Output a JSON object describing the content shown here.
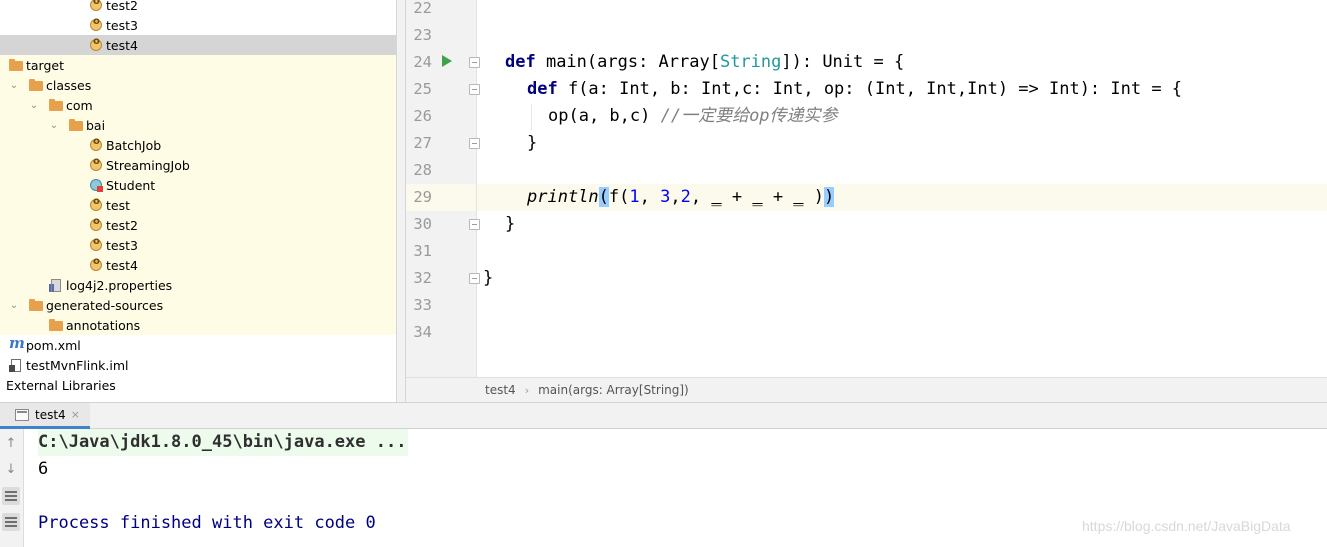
{
  "project_tree": {
    "items": [
      {
        "label": "test2",
        "icon": "scala-object-icon",
        "arrow": ""
      },
      {
        "label": "test3",
        "icon": "scala-object-icon",
        "arrow": ""
      },
      {
        "label": "test4",
        "icon": "scala-object-icon",
        "arrow": "",
        "selected": true
      },
      {
        "label": "target",
        "icon": "folder-icon",
        "arrow": ""
      },
      {
        "label": "classes",
        "icon": "folder-icon",
        "arrow": "⌄"
      },
      {
        "label": "com",
        "icon": "folder-icon",
        "arrow": "⌄"
      },
      {
        "label": "bai",
        "icon": "folder-icon",
        "arrow": "⌄"
      },
      {
        "label": "BatchJob",
        "icon": "scala-object-icon",
        "arrow": ""
      },
      {
        "label": "StreamingJob",
        "icon": "scala-object-icon",
        "arrow": ""
      },
      {
        "label": "Student",
        "icon": "scala-class-icon",
        "arrow": ""
      },
      {
        "label": "test",
        "icon": "scala-object-icon",
        "arrow": ""
      },
      {
        "label": "test2",
        "icon": "scala-object-icon",
        "arrow": ""
      },
      {
        "label": "test3",
        "icon": "scala-object-icon",
        "arrow": ""
      },
      {
        "label": "test4",
        "icon": "scala-object-icon",
        "arrow": ""
      },
      {
        "label": "log4j2.properties",
        "icon": "properties-file-icon",
        "arrow": ""
      },
      {
        "label": "generated-sources",
        "icon": "folder-icon",
        "arrow": "⌄"
      },
      {
        "label": "annotations",
        "icon": "folder-icon",
        "arrow": ""
      },
      {
        "label": "pom.xml",
        "icon": "maven-pom-icon",
        "arrow": ""
      },
      {
        "label": "testMvnFlink.iml",
        "icon": "iml-file-icon",
        "arrow": ""
      },
      {
        "label": "External Libraries",
        "icon": "",
        "arrow": ""
      }
    ]
  },
  "editor": {
    "line_numbers": [
      "22",
      "23",
      "24",
      "25",
      "26",
      "27",
      "28",
      "29",
      "30",
      "31",
      "32",
      "33",
      "34"
    ],
    "code": {
      "l24_kw": "def",
      "l24_a": " main(args: Array[",
      "l24_type": "String",
      "l24_b": "]): Unit = {",
      "l25_kw": "def",
      "l25_a": " f(a: Int, b: Int,c: Int, op: (Int, Int,Int) => Int): Int = {",
      "l26_a": "op(a, b,c) ",
      "l26_comment": "//一定要给op传递实参",
      "l27": "}",
      "l29_fn": "println",
      "l29_open": "(",
      "l29_a": "f(",
      "l29_n1": "1",
      "l29_c1": ", ",
      "l29_n2": "3",
      "l29_c2": ",",
      "l29_n3": "2",
      "l29_c3": ", ",
      "l29_u1": "_",
      "l29_p1": " + ",
      "l29_u2": "_",
      "l29_p2": " + ",
      "l29_u3": "_",
      "l29_sp": " )",
      "l29_close": ")",
      "l30": "}",
      "l32": "}"
    },
    "breadcrumb": [
      "test4",
      "main(args: Array[String])"
    ],
    "breadcrumb_sep": "›"
  },
  "run_panel": {
    "tab_label": "test4",
    "tab_close": "×",
    "tools": [
      "up-arrow-icon",
      "down-arrow-icon",
      "soft-wrap-icon",
      "scroll-to-end-icon"
    ],
    "console": {
      "command": "C:\\Java\\jdk1.8.0_45\\bin\\java.exe ...",
      "output": "6",
      "exit": "Process finished with exit code 0"
    },
    "tool_glyphs": {
      "up": "↑",
      "down": "↓"
    }
  },
  "watermark": "https://blog.csdn.net/JavaBigData",
  "colors": {
    "keyword": "#000080",
    "type": "#20999d",
    "number": "#0000ff",
    "comment": "#808080",
    "tree_highlight": "#fefce4",
    "console_cmd_bg": "#edfbed"
  }
}
